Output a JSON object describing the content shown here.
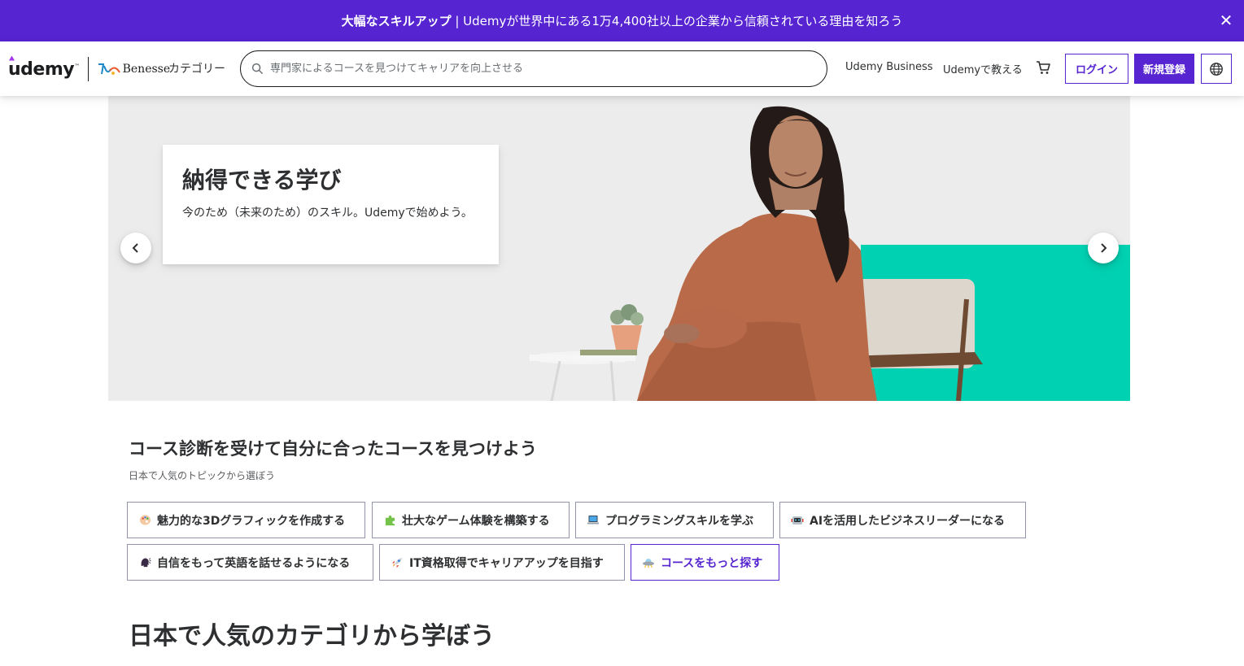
{
  "banner": {
    "bold": "大幅なスキルアップ",
    "rest": " | Udemyが世界中にある1万4,400社以上の企業から信頼されている理由を知ろう",
    "close_icon": "✕"
  },
  "header": {
    "logo_text": "Udemy",
    "logo_tm": "™",
    "partner_logo_text": "Benesse",
    "categories_label": "カテゴリー",
    "search_placeholder": "専門家によるコースを見つけてキャリアを向上させる",
    "business_link": "Udemy Business",
    "teach_link": "Udemyで教える",
    "login_label": "ログイン",
    "signup_label": "新規登録"
  },
  "hero": {
    "title": "納得できる学び",
    "subtitle": "今のため（未来のため）のスキル。Udemyで始めよう。",
    "accent_color": "#00d1b2"
  },
  "quiz": {
    "title": "コース診断を受けて自分に合ったコースを見つけよう",
    "subtitle": "日本で人気のトピックから選ぼう",
    "chips": [
      {
        "icon": "palette-icon",
        "label": "魅力的な3Dグラフィックを作成する"
      },
      {
        "icon": "puzzle-icon",
        "label": "壮大なゲーム体験を構築する"
      },
      {
        "icon": "laptop-icon",
        "label": "プログラミングスキルを学ぶ"
      },
      {
        "icon": "robot-icon",
        "label": "AIを活用したビジネスリーダーになる"
      },
      {
        "icon": "speaking-head-icon",
        "label": "自信をもって英語を話せるようになる"
      },
      {
        "icon": "rocket-icon",
        "label": "IT資格取得でキャリアアップを目指す"
      },
      {
        "icon": "ufo-icon",
        "label": "コースをもっと探す"
      }
    ]
  },
  "categories": {
    "title": "日本で人気のカテゴリから学ぼう"
  },
  "colors": {
    "brand": "#5624d0",
    "text": "#2d2f31"
  }
}
